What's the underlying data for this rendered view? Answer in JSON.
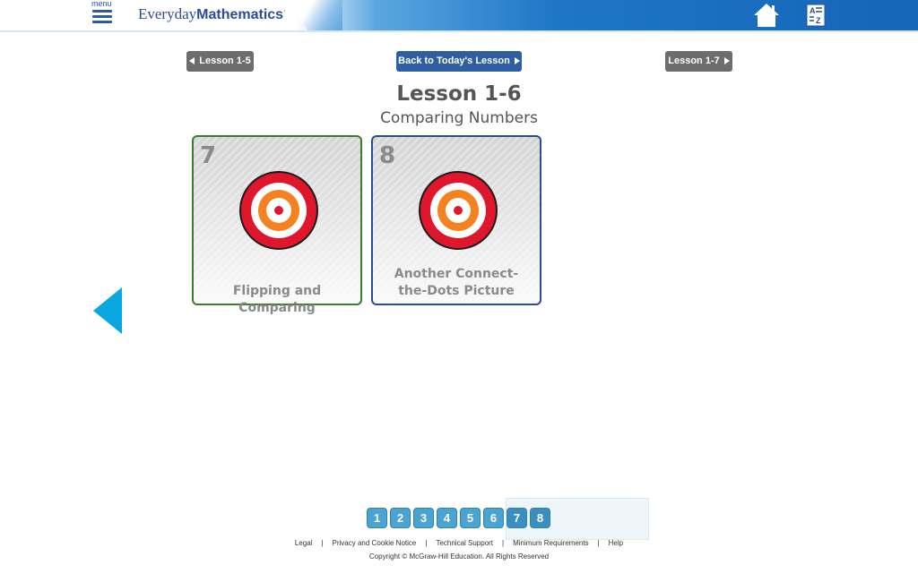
{
  "header": {
    "menu_label": "menu",
    "logo_part1": "Everyday",
    "logo_part2": "Mathematics",
    "logo_mark": "·"
  },
  "nav": {
    "prev_label": "Lesson 1-5",
    "back_label": "Back to Today's Lesson",
    "next_label": "Lesson 1-7"
  },
  "lesson": {
    "title": "Lesson 1-6",
    "subtitle": "Comparing Numbers"
  },
  "cards": [
    {
      "number": "7",
      "line1": "",
      "line2": "Flipping and Comparing",
      "border_color": "#3a7d2a"
    },
    {
      "number": "8",
      "line1": "Another Connect-",
      "line2": "the-Dots Picture",
      "border_color": "#2b4c97"
    }
  ],
  "pager": {
    "pages": [
      "1",
      "2",
      "3",
      "4",
      "5",
      "6",
      "7",
      "8"
    ]
  },
  "footer": {
    "links": [
      "Legal",
      "Privacy and Cookie Notice",
      "Technical Support",
      "Minimum Requirements",
      "Help"
    ],
    "separator": "|",
    "copyright": "Copyright © McGraw-Hill Education. All Rights Reserved"
  },
  "icons": {
    "menu": "hamburger-menu-icon",
    "home": "home-icon",
    "glossary": "glossary-a-z-icon",
    "target": "bullseye-target-icon",
    "back_arrow": "left-triangle-arrow-icon"
  },
  "colors": {
    "header_blue": "#1f76c6",
    "nav_gray": "#6d6d6d",
    "nav_blue": "#2f5fa3",
    "arrow_cyan": "#0aa6df",
    "page_button": "#4aa3d0"
  }
}
